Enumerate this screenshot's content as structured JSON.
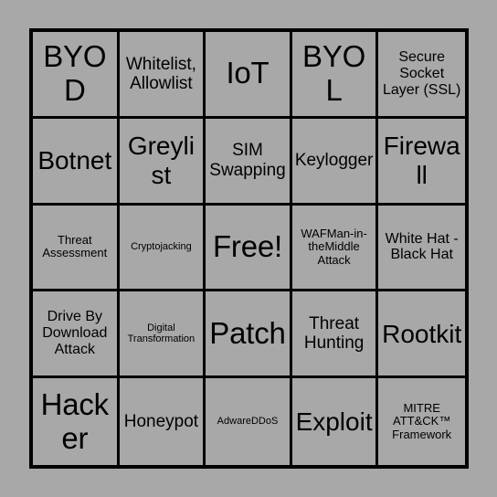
{
  "card": {
    "type": "bingo-card",
    "columns": 5,
    "rows": 5,
    "background_color": "#a8a8a8",
    "border_color": "#000000",
    "text_color": "#000000",
    "free_space_index": 12,
    "cells": [
      {
        "label": "BYOD",
        "size": "xl"
      },
      {
        "label": "Whitelist, Allowlist",
        "size": "md"
      },
      {
        "label": "IoT",
        "size": "xl"
      },
      {
        "label": "BYOL",
        "size": "xl"
      },
      {
        "label": "Secure Socket Layer (SSL)",
        "size": "sm"
      },
      {
        "label": "Botnet",
        "size": "lg"
      },
      {
        "label": "Greylist",
        "size": "lg"
      },
      {
        "label": "SIM Swapping",
        "size": "md"
      },
      {
        "label": "Keylogger",
        "size": "md"
      },
      {
        "label": "Firewall",
        "size": "lg"
      },
      {
        "label": "Threat Assessment",
        "size": "xs"
      },
      {
        "label": "Cryptojacking",
        "size": "xxs"
      },
      {
        "label": "Free!",
        "size": "xl"
      },
      {
        "label": "WAFMan-in-theMiddle Attack",
        "size": "xs"
      },
      {
        "label": "White Hat - Black Hat",
        "size": "sm"
      },
      {
        "label": "Drive By Download Attack",
        "size": "sm"
      },
      {
        "label": "Digital Transformation",
        "size": "xxs"
      },
      {
        "label": "Patch",
        "size": "xl"
      },
      {
        "label": "Threat Hunting",
        "size": "md"
      },
      {
        "label": "Rootkit",
        "size": "lg"
      },
      {
        "label": "Hacker",
        "size": "xl"
      },
      {
        "label": "Honeypot",
        "size": "md"
      },
      {
        "label": "AdwareDDoS",
        "size": "xxs"
      },
      {
        "label": "Exploit",
        "size": "lg"
      },
      {
        "label": "MITRE ATT&CK™ Framework",
        "size": "xs"
      }
    ]
  }
}
